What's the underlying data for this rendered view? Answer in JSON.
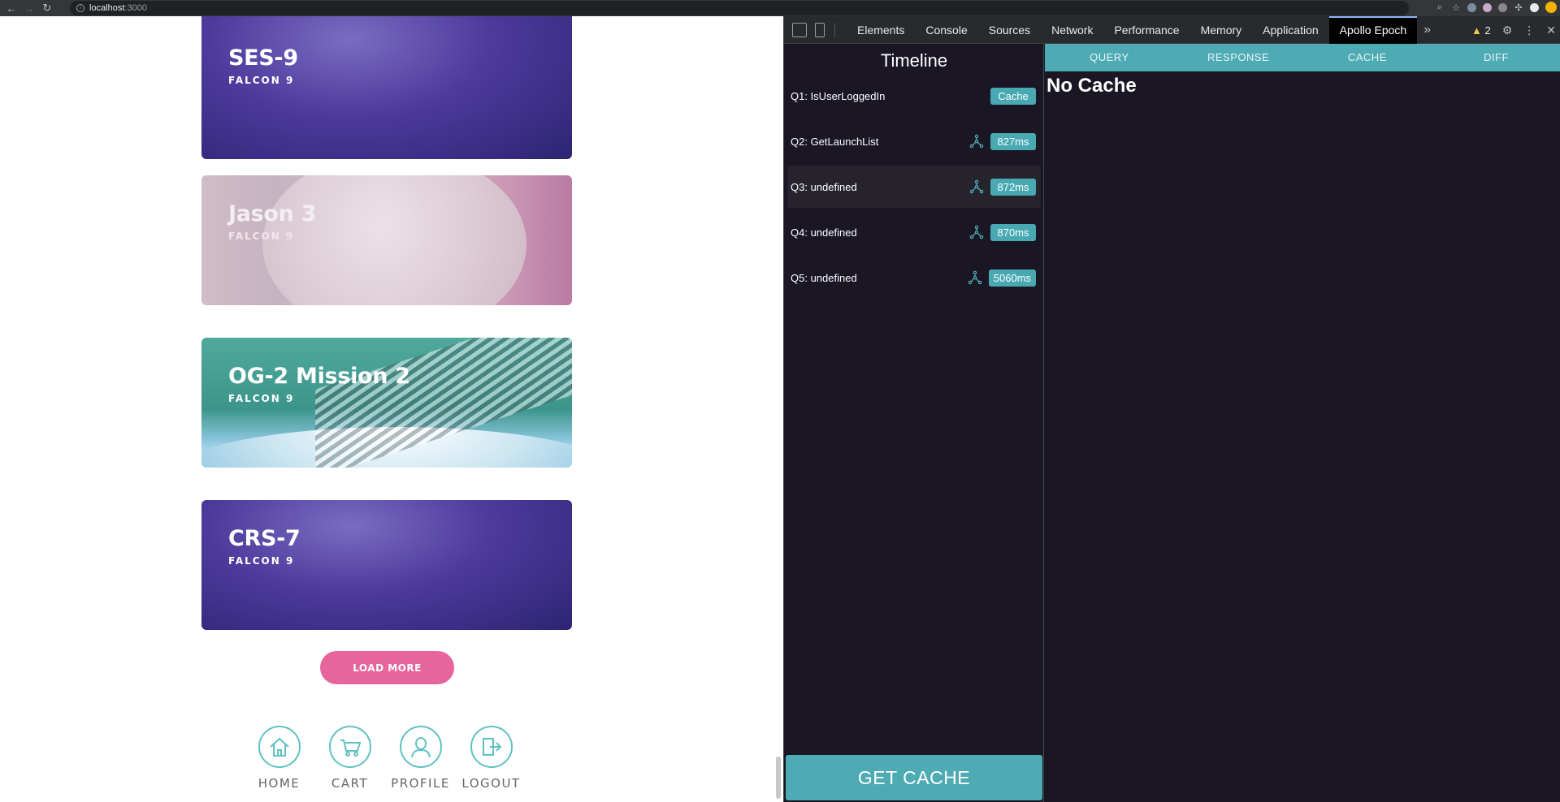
{
  "browser": {
    "url_host": "localhost",
    "url_port": ":3000"
  },
  "launches": [
    {
      "name": "SES-9",
      "rocket": "FALCON 9"
    },
    {
      "name": "Jason 3",
      "rocket": "FALCON 9"
    },
    {
      "name": "OG-2 Mission 2",
      "rocket": "FALCON 9"
    },
    {
      "name": "CRS-7",
      "rocket": "FALCON 9"
    }
  ],
  "load_more_label": "LOAD MORE",
  "footer_nav": [
    {
      "label": "HOME",
      "icon": "home-icon"
    },
    {
      "label": "CART",
      "icon": "cart-icon"
    },
    {
      "label": "PROFILE",
      "icon": "profile-icon"
    },
    {
      "label": "LOGOUT",
      "icon": "logout-icon"
    }
  ],
  "devtools": {
    "tabs": [
      "Elements",
      "Console",
      "Sources",
      "Network",
      "Performance",
      "Memory",
      "Application",
      "Apollo Epoch"
    ],
    "active_tab": "Apollo Epoch",
    "warning_count": "2"
  },
  "timeline": {
    "title": "Timeline",
    "queries": [
      {
        "label": "Q1: IsUserLoggedIn",
        "badge": "Cache",
        "graph_icon": false
      },
      {
        "label": "Q2: GetLaunchList",
        "badge": "827ms",
        "graph_icon": true
      },
      {
        "label": "Q3: undefined",
        "badge": "872ms",
        "graph_icon": true,
        "selected": true
      },
      {
        "label": "Q4: undefined",
        "badge": "870ms",
        "graph_icon": true
      },
      {
        "label": "Q5: undefined",
        "badge": "5060ms",
        "graph_icon": true
      }
    ],
    "get_cache_label": "GET CACHE"
  },
  "detail": {
    "tabs": [
      "QUERY",
      "RESPONSE",
      "CACHE",
      "DIFF"
    ],
    "message": "No Cache"
  },
  "colors": {
    "accent_teal": "#4eabb4",
    "load_more_pink": "#e6659c",
    "devtools_bg": "#1a1624"
  }
}
